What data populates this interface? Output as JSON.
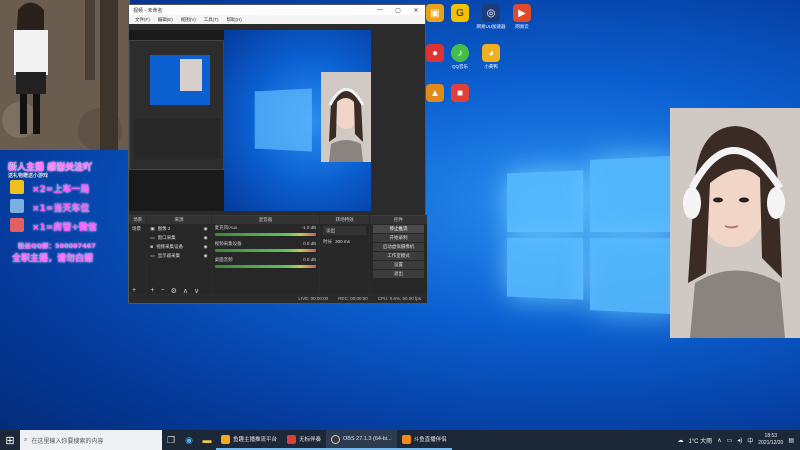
{
  "overlay": {
    "title": "新人主播 感谢关注吖",
    "subtitle": "送礼物赠送小游戏",
    "line1": "×2=上车一局",
    "line2": "×1=当天车位",
    "line3": "×1=房管+微信",
    "contact": "粉丝QQ群：500007467",
    "final": "全职主播，请勿白嫖"
  },
  "desktop_icons": [
    {
      "label": "",
      "color": "#e9a21a",
      "glyph": "▣"
    },
    {
      "label": "",
      "color": "#2b2b2b",
      "glyph": "G"
    },
    {
      "label": "网易UU加速器",
      "color": "#1f3c7a",
      "glyph": "◎"
    },
    {
      "label": "网易云",
      "color": "#e04a2a",
      "glyph": "▶"
    },
    {
      "label": "",
      "color": "#d33",
      "glyph": "●"
    },
    {
      "label": "QQ音乐",
      "color": "#44c04a",
      "glyph": "♪"
    },
    {
      "label": "小黄鸭",
      "color": "#f2b020",
      "glyph": "◕"
    },
    {
      "label": "",
      "color": "#e08a1a",
      "glyph": "▲"
    },
    {
      "label": "",
      "color": "#e0403a",
      "glyph": "■"
    }
  ],
  "obs": {
    "title": "视频 - 未命名",
    "menu": [
      "文件(F)",
      "编辑(E)",
      "视图(V)",
      "工具(T)",
      "帮助(H)"
    ],
    "scenes_header": "场景",
    "sources_header": "来源",
    "mixer_header": "混音器",
    "transitions_header": "转场特效",
    "controls_header": "控件",
    "sources": [
      {
        "name": "图像 2"
      },
      {
        "name": "窗口采集"
      },
      {
        "name": "视频采集设备"
      },
      {
        "name": "显示器采集"
      }
    ],
    "scene_current": "场景",
    "mixer": [
      {
        "name": "麦克风/Aux",
        "db": "-1.0 dB"
      },
      {
        "name": "视频采集设备",
        "db": "0.0 dB"
      },
      {
        "name": "桌面音频",
        "db": "0.0 dB"
      }
    ],
    "transition": "淡出",
    "duration_label": "时长",
    "duration_value": "300 ms",
    "controls": [
      "停止推流",
      "开始录制",
      "启动虚拟摄像机",
      "工作室模式",
      "设置",
      "退出"
    ],
    "status": {
      "live": "LIVE: 00:00:00",
      "rec": "REC: 00:00:00",
      "cpu": "CPU: 0.6%, 60.00 fps"
    }
  },
  "taskbar": {
    "search_placeholder": "在这里输入你要搜索的内容",
    "apps": [
      {
        "label": "鱼趣主播推流平台",
        "color": "#f5a623"
      },
      {
        "label": "无标伴奏",
        "color": "#d9403a"
      },
      {
        "label": "OBS 27.1.3 (64-bi...",
        "color": "#3a3a3a"
      },
      {
        "label": "斗鱼直播伴侣",
        "color": "#f08a1a"
      }
    ],
    "weather": "1°C 大雨",
    "lang": "中",
    "time": "18:53",
    "date": "2021/12/20"
  },
  "colors": {
    "overlay_pink": "#ff66ff",
    "desktop_blue": "#0b5fd0",
    "taskbar": "#1c2838"
  }
}
